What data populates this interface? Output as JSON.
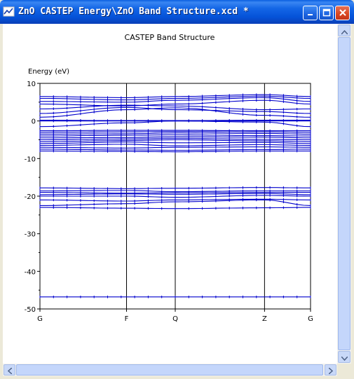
{
  "window": {
    "title": "ZnO CASTEP Energy\\ZnO Band Structure.xcd *",
    "icons": [
      "chart-app-icon",
      "minimize-icon",
      "maximize-icon",
      "close-icon"
    ]
  },
  "colors": {
    "titlebar": "#0553d9",
    "band": "#0000cc",
    "axis": "#000000"
  },
  "chart_data": {
    "type": "line",
    "title": "CASTEP Band Structure",
    "ylabel": "Energy (eV)",
    "xlabel": "",
    "ylim": [
      -50,
      10
    ],
    "yticks": [
      10,
      0,
      -10,
      -20,
      -30,
      -40,
      -50
    ],
    "ytick_labels": [
      "10",
      "0",
      "-10",
      "-20",
      "-30",
      "-40",
      "-50"
    ],
    "kpath_labels": [
      "G",
      "F",
      "Q",
      "Z",
      "G"
    ],
    "kpath_positions": [
      0,
      0.32,
      0.5,
      0.83,
      1.0
    ],
    "grid": "vertical lines at high-symmetry points",
    "bands": [
      {
        "y": [
          -46.8,
          -46.8,
          -46.8,
          -46.8,
          -46.8
        ]
      },
      {
        "y": [
          -23.0,
          -23.2,
          -23.3,
          -23.1,
          -23.0
        ]
      },
      {
        "y": [
          -22.5,
          -22.0,
          -21.5,
          -21.0,
          -22.5
        ]
      },
      {
        "y": [
          -21.0,
          -21.3,
          -21.0,
          -20.8,
          -21.0
        ]
      },
      {
        "y": [
          -20.0,
          -20.0,
          -20.3,
          -19.8,
          -20.0
        ]
      },
      {
        "y": [
          -19.6,
          -19.4,
          -19.5,
          -19.3,
          -19.6
        ]
      },
      {
        "y": [
          -19.0,
          -19.2,
          -19.1,
          -19.0,
          -19.0
        ]
      },
      {
        "y": [
          -18.6,
          -18.5,
          -18.8,
          -18.6,
          -18.6
        ]
      },
      {
        "y": [
          -17.8,
          -18.0,
          -17.9,
          -17.7,
          -17.8
        ]
      },
      {
        "y": [
          -8.0,
          -8.1,
          -8.2,
          -8.0,
          -8.0
        ]
      },
      {
        "y": [
          -7.5,
          -7.7,
          -7.8,
          -7.6,
          -7.5
        ]
      },
      {
        "y": [
          -7.0,
          -7.2,
          -7.0,
          -6.9,
          -7.0
        ]
      },
      {
        "y": [
          -6.5,
          -6.2,
          -6.6,
          -6.3,
          -6.5
        ]
      },
      {
        "y": [
          -6.0,
          -5.6,
          -5.8,
          -5.7,
          -6.0
        ]
      },
      {
        "y": [
          -5.5,
          -5.2,
          -5.0,
          -5.3,
          -5.5
        ]
      },
      {
        "y": [
          -5.0,
          -4.8,
          -4.6,
          -4.9,
          -5.0
        ]
      },
      {
        "y": [
          -4.5,
          -4.4,
          -4.2,
          -4.3,
          -4.5
        ]
      },
      {
        "y": [
          -4.0,
          -3.8,
          -3.7,
          -3.9,
          -4.0
        ]
      },
      {
        "y": [
          -3.5,
          -3.4,
          -3.2,
          -3.3,
          -3.5
        ]
      },
      {
        "y": [
          -3.0,
          -2.9,
          -2.8,
          -2.9,
          -3.0
        ]
      },
      {
        "y": [
          -2.6,
          -2.5,
          -2.5,
          -2.6,
          -2.6
        ]
      },
      {
        "y": [
          -1.5,
          -0.5,
          0.0,
          -0.3,
          -1.5
        ]
      },
      {
        "y": [
          0.0,
          0.0,
          0.0,
          0.0,
          0.0
        ]
      },
      {
        "y": [
          0.2,
          0.1,
          0.1,
          0.2,
          0.2
        ]
      },
      {
        "y": [
          1.0,
          3.0,
          3.5,
          1.5,
          1.0
        ]
      },
      {
        "y": [
          2.0,
          3.6,
          3.0,
          2.5,
          2.0
        ]
      },
      {
        "y": [
          3.2,
          4.2,
          4.0,
          3.0,
          3.2
        ]
      },
      {
        "y": [
          4.5,
          4.0,
          4.5,
          5.5,
          4.5
        ]
      },
      {
        "y": [
          5.2,
          5.0,
          5.5,
          6.2,
          5.2
        ]
      },
      {
        "y": [
          6.0,
          5.6,
          6.0,
          6.6,
          6.0
        ]
      },
      {
        "y": [
          6.5,
          6.2,
          6.5,
          7.0,
          6.5
        ]
      }
    ]
  }
}
